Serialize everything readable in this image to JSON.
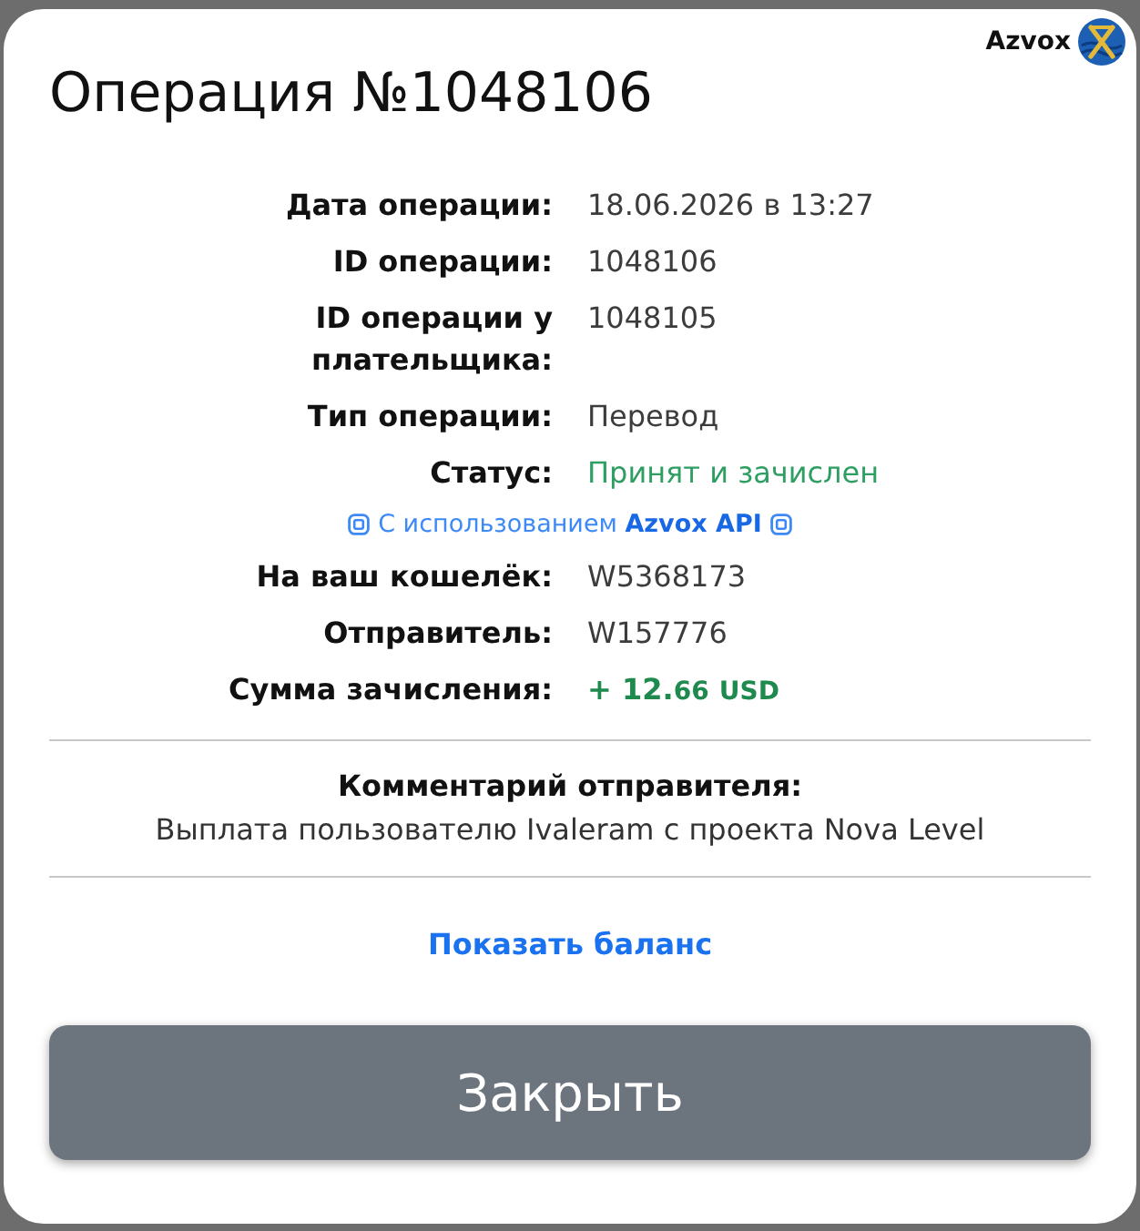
{
  "logo": {
    "text": "Azvox"
  },
  "title": "Операция №1048106",
  "details": [
    {
      "kind": "text",
      "label": "Дата операции:",
      "value": "18.06.2026 в 13:27"
    },
    {
      "kind": "text",
      "label": "ID операции:",
      "value": "1048106"
    },
    {
      "kind": "text",
      "label": "ID операции у плательщика:",
      "value": "1048105"
    },
    {
      "kind": "text",
      "label": "Тип операции:",
      "value": "Перевод"
    },
    {
      "kind": "status",
      "label": "Статус:",
      "value": "Принят и зачислен"
    },
    {
      "kind": "note",
      "text": "С использованием **Azvox API**"
    },
    {
      "kind": "text",
      "label": "На ваш кошелёк:",
      "value": "W5368173"
    },
    {
      "kind": "text",
      "label": "Отправитель:",
      "value": "W157776"
    },
    {
      "kind": "amount",
      "label": "Сумма зачисления:",
      "whole": "+ 12.",
      "fraction": "66",
      "currency": "USD"
    }
  ],
  "comment": {
    "heading": "Комментарий отправителя:",
    "text": "Выплата пользователю Ivaleram с проекта Nova Level"
  },
  "balance_link": "Показать баланс",
  "close_button": "Закрыть"
}
